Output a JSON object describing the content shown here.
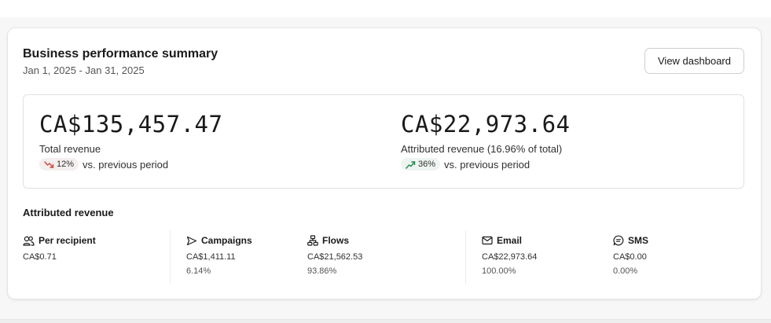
{
  "summary": {
    "title": "Business performance summary",
    "date_range": "Jan 1, 2025 - Jan 31, 2025",
    "view_dashboard_label": "View dashboard"
  },
  "metrics": {
    "total": {
      "value": "CA$135,457.47",
      "label": "Total revenue",
      "change": "12%",
      "direction": "down",
      "direction_icon": "trend-down-icon",
      "comparison": "vs. previous period",
      "color": "#d1453b"
    },
    "attributed": {
      "value": "CA$22,973.64",
      "label": "Attributed revenue (16.96% of total)",
      "change": "36%",
      "direction": "up",
      "direction_icon": "trend-up-icon",
      "comparison": "vs. previous period",
      "color": "#1f8a4c"
    }
  },
  "attributed_revenue": {
    "heading": "Attributed revenue",
    "columns": [
      {
        "icon": "users-icon",
        "title": "Per recipient",
        "value": "CA$0.71",
        "percent": ""
      },
      {
        "icon": "send-icon",
        "title": "Campaigns",
        "value": "CA$1,411.11",
        "percent": "6.14%"
      },
      {
        "icon": "flows-icon",
        "title": "Flows",
        "value": "CA$21,562.53",
        "percent": "93.86%"
      },
      {
        "icon": "email-icon",
        "title": "Email",
        "value": "CA$22,973.64",
        "percent": "100.00%"
      },
      {
        "icon": "sms-icon",
        "title": "SMS",
        "value": "CA$0.00",
        "percent": "0.00%"
      }
    ]
  }
}
